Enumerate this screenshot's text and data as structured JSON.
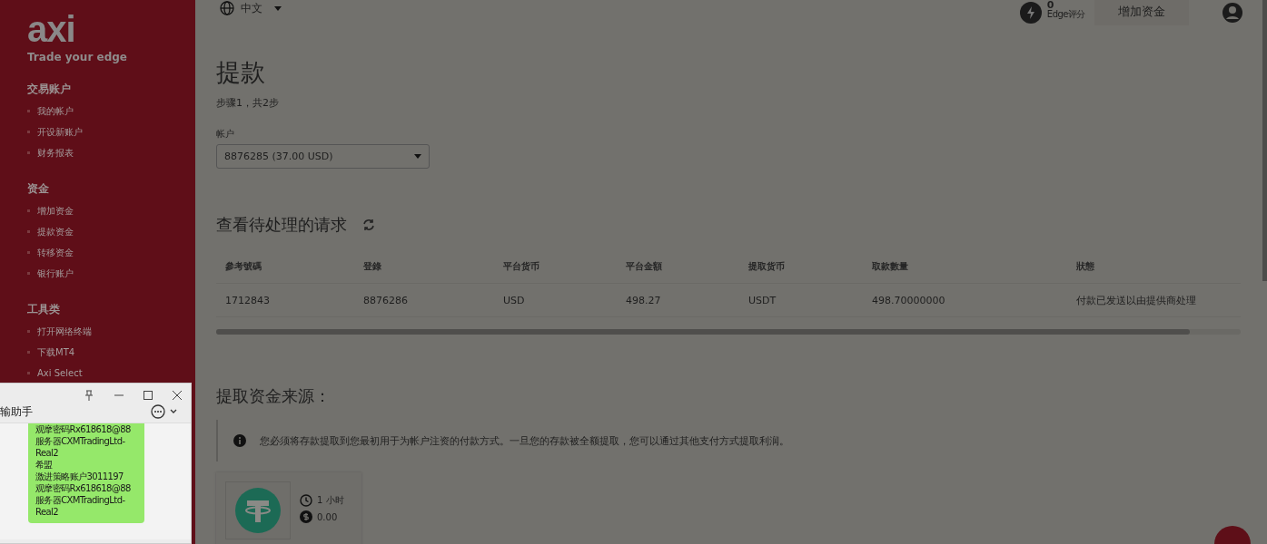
{
  "sidebar": {
    "logo": "axi",
    "tagline": "Trade your edge",
    "sections": [
      {
        "title": "交易账户",
        "items": [
          "我的帐户",
          "开设新账户",
          "财务报表"
        ]
      },
      {
        "title": "资金",
        "items": [
          "增加资金",
          "提款资金",
          "转移资金",
          "银行账户"
        ]
      },
      {
        "title": "工具类",
        "items": [
          "打开网络终端",
          "下载MT4",
          "Axi Select"
        ]
      }
    ]
  },
  "topbar": {
    "language": "中文",
    "edge_score": "0",
    "edge_label": "Edge评分",
    "add_funds_button": "增加资金"
  },
  "page": {
    "title": "提款",
    "step": "步骤1，共2步",
    "account_label": "帐户",
    "account_value": "8876285 (37.00 USD)"
  },
  "pending": {
    "title": "查看待处理的请求",
    "columns": [
      "參考號碼",
      "登錄",
      "平台货币",
      "平台金額",
      "提取货币",
      "取款數量",
      "狀態"
    ],
    "rows": [
      [
        "1712843",
        "8876286",
        "USD",
        "498.27",
        "USDT",
        "498.70000000",
        "付款已发送以由提供商处理"
      ]
    ]
  },
  "sources": {
    "title": "提取资金来源：",
    "notice": "您必须将存款提取到您最初用于为帐户注资的付款方式。一旦您的存款被全额提取，您可以通过其他支付方式提取利润。",
    "methods": [
      {
        "time": "1 小时",
        "fee": "0.00"
      }
    ]
  },
  "chat_window": {
    "title": "输助手",
    "message_lines": [
      "观摩密码Rx618618@88",
      "服务器CXMTradingLtd-",
      "Real2",
      "希盟",
      "激进策略账户3011197",
      "观摩密码Rx618618@88",
      "服务器CXMTradingLtd-",
      "Real2"
    ]
  }
}
